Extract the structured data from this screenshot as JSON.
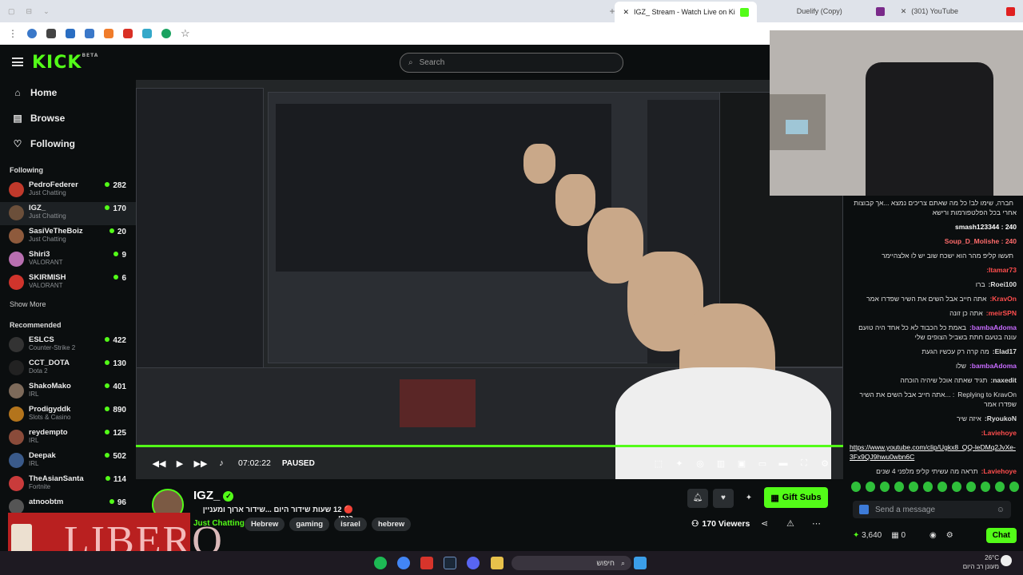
{
  "browser": {
    "tabs": [
      {
        "label": "IGZ_ Stream - Watch Live on Ki",
        "active": true
      },
      {
        "label": "Duelify (Copy)",
        "active": false
      },
      {
        "label": "(301) YouTube",
        "active": false
      }
    ]
  },
  "header": {
    "logo": "KICK",
    "logo_badge": "BETA",
    "search_placeholder": "Search"
  },
  "sidebar": {
    "nav": [
      {
        "label": "Home",
        "icon": "home-icon"
      },
      {
        "label": "Browse",
        "icon": "browse-icon"
      },
      {
        "label": "Following",
        "icon": "heart-icon"
      }
    ],
    "following_title": "Following",
    "following": [
      {
        "name": "PedroFederer",
        "sub": "Just Chatting",
        "viewers": "282",
        "color": "#c0392b"
      },
      {
        "name": "IGZ_",
        "sub": "Just Chatting",
        "viewers": "170",
        "color": "#6b4f3a"
      },
      {
        "name": "SasiVeTheBoiz",
        "sub": "Just Chatting",
        "viewers": "20",
        "color": "#8e5a3c"
      },
      {
        "name": "Shiri3",
        "sub": "VALORANT",
        "viewers": "9",
        "color": "#b86fb0"
      },
      {
        "name": "SKIRMISH",
        "sub": "VALORANT",
        "viewers": "6",
        "color": "#d0342c"
      }
    ],
    "show_more": "Show More",
    "recommended_title": "Recommended",
    "recommended": [
      {
        "name": "ESLCS",
        "sub": "Counter-Strike 2",
        "viewers": "422",
        "color": "#333"
      },
      {
        "name": "CCT_DOTA",
        "sub": "Dota 2",
        "viewers": "130",
        "color": "#222"
      },
      {
        "name": "ShakoMako",
        "sub": "IRL",
        "viewers": "401",
        "color": "#7d6a5a"
      },
      {
        "name": "Prodigyddk",
        "sub": "Slots & Casino",
        "viewers": "890",
        "color": "#b3741c"
      },
      {
        "name": "reydempto",
        "sub": "IRL",
        "viewers": "125",
        "color": "#8a4b3a"
      },
      {
        "name": "Deepak",
        "sub": "IRL",
        "viewers": "502",
        "color": "#3a5a8a"
      },
      {
        "name": "TheAsianSanta",
        "sub": "Fortnite",
        "viewers": "114",
        "color": "#c93b3b"
      },
      {
        "name": "atnoobtm",
        "sub": "",
        "viewers": "96",
        "color": "#555"
      }
    ]
  },
  "player": {
    "time": "07:02:22",
    "state": "PAUSED"
  },
  "stream": {
    "name": "IGZ_",
    "title": "🔴 12 שעות שידור היום ...שידור ארוך ומעניין כנסו",
    "category": "Just Chatting",
    "tags": [
      "Hebrew",
      "gaming",
      "israel",
      "hebrew"
    ],
    "gift_label": "Gift Subs",
    "viewers": "170 Viewers"
  },
  "chat": {
    "messages": [
      {
        "user": "",
        "text": "חברה, שימו לב! כל מה שאתם צריכים נמצא ...אך קבוצות אחרי בכל הפלטפורמות ורישא",
        "color": "#ddd"
      },
      {
        "user": "smash123344 : 240",
        "text": "",
        "color": "#fff"
      },
      {
        "user": "Soup_D_Molishe : 240",
        "text": "",
        "color": "#ff6b6b"
      },
      {
        "user": "",
        "text": "תעשו קליפ מהר הוא ישכח שוב יש לו אלצהיימר",
        "color": "#ddd"
      },
      {
        "user": "Itamar73:",
        "text": "",
        "color": "#ff4d4d"
      },
      {
        "user": "Roei100:",
        "text": "ברו",
        "color": "#ddd"
      },
      {
        "user": "KravOn:",
        "text": "אתה חייב אבל השים את השיר שפדרו אמר",
        "color": "#ff4d4d"
      },
      {
        "user": "meirSPN:",
        "text": "אתה כן זונה",
        "color": "#ff4d4d"
      },
      {
        "user": "bambaAdoma:",
        "text": "באמת כל הכבוד לא כל אחד היה טועם עונה בטעם חתת בשביל הצופים שלי",
        "color": "#c76bff"
      },
      {
        "user": "Elad17:",
        "text": "מה קרה רק עכשיו הגעת",
        "color": "#ddd"
      },
      {
        "user": "bambaAdoma:",
        "text": "שלו",
        "color": "#c76bff"
      },
      {
        "user": "naxedit:",
        "text": "תגיד שאתה אוכל שיהיה הוכחה",
        "color": "#ddd"
      },
      {
        "user": "",
        "text": "Replying to KravOn: ...אתה חייב אבל השים את השיר שפדרו אמר",
        "color": "#888"
      },
      {
        "user": "RyoukoN:",
        "text": "איזה שיר",
        "color": "#ddd"
      },
      {
        "user": "Laviehoye:",
        "text": "",
        "color": "#ff4d4d"
      }
    ],
    "link": "https://www.youtube.com/clip/Ugkx8_QQ-leDMq2JvXe-3Fx9QJ9hwu0wbn6C",
    "last_user": "Laviehoye:",
    "last_text": "תראה מה עשיתי קליפ מלפני 4 שנים",
    "input_placeholder": "Send a message",
    "points": "3,640",
    "count": "0",
    "send_label": "Chat"
  },
  "ad": {
    "text": "LIBERO"
  },
  "taskbar": {
    "search_label": "חיפוש",
    "temp": "26°C",
    "weather": "מעונן רב היום"
  }
}
